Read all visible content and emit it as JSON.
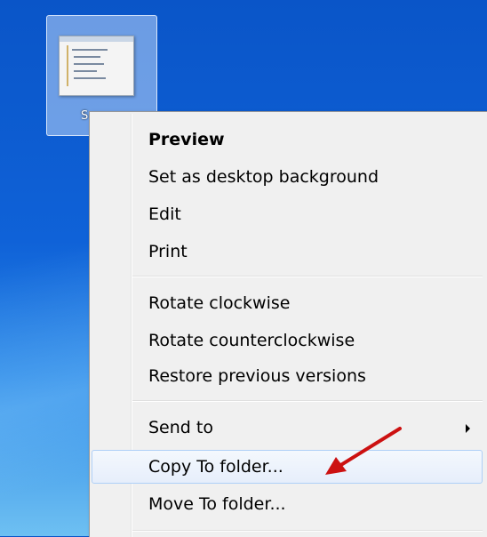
{
  "desktop": {
    "icon_caption": "S"
  },
  "context_menu": {
    "items": [
      {
        "label": "Preview"
      },
      {
        "label": "Set as desktop background"
      },
      {
        "label": "Edit"
      },
      {
        "label": "Print"
      },
      {
        "label": "Rotate clockwise"
      },
      {
        "label": "Rotate counterclockwise"
      },
      {
        "label": "Restore previous versions"
      },
      {
        "label": "Send to"
      },
      {
        "label": "Copy To folder..."
      },
      {
        "label": "Move To folder..."
      }
    ]
  },
  "annotation": {
    "arrow_color": "#cc1111",
    "points_to": "Copy To folder..."
  }
}
